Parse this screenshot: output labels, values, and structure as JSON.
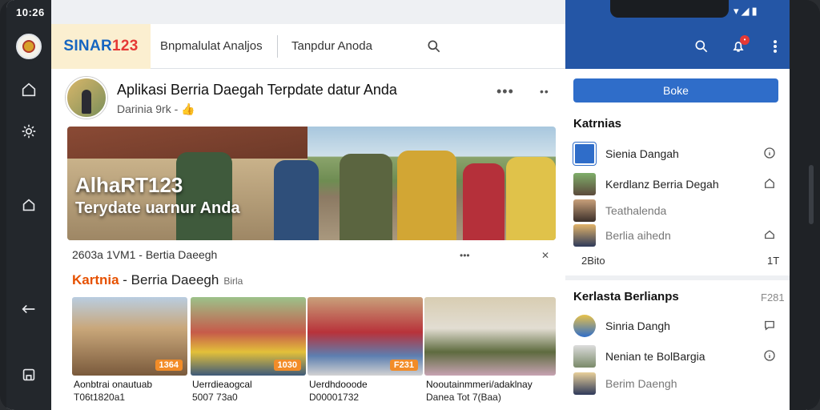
{
  "status": {
    "time": "10:26"
  },
  "colors": {
    "brand_blue": "#1565c0",
    "brand_red": "#e53935",
    "accent_orange": "#e65100",
    "panel_blue": "#2456a6",
    "button_blue": "#2f6dc9"
  },
  "rail": {
    "icons": [
      "home-icon",
      "gear-icon",
      "circle-home-icon",
      "back-icon",
      "square-home-icon"
    ]
  },
  "header": {
    "brand_text": "SINAR",
    "brand_num": "123",
    "menu1": "Bnpmalulat Analjos",
    "menu2": "Tanpdur Anoda"
  },
  "post": {
    "title": "Aplikasi Berria Daegah Terpdate datur Anda",
    "subtitle": "Darinia 9rk -",
    "hero_line1": "AlhaRT123",
    "hero_line2": "Terydate uarnur Anda",
    "meta": "2603a 1VM1   -  Bertia Daeegh"
  },
  "section": {
    "accent": "Kartnia",
    "title": " - Berria Daeegh",
    "tag": "Birla"
  },
  "cards": [
    {
      "badge": "1364",
      "cap1": "Aonbtrai onautuab",
      "cap2": "T06t1820a1"
    },
    {
      "badge": "1030",
      "cap1": "Uerrdieaogcal",
      "cap2": "5007 73a0"
    },
    {
      "badge": "F231",
      "cap1": "Uerdhdooode",
      "cap2": "D00001732"
    },
    {
      "badge": "",
      "cap1": "Nooutainmmeri/adaklnay",
      "cap2": "Danea Tot 7(Baa)"
    }
  ],
  "right": {
    "button": "Boke",
    "section1_title": "Katrnias",
    "rows1": [
      {
        "text": "Sienia Dangah"
      },
      {
        "text": "Kerdlanz Berria Degah"
      },
      {
        "text": "Teathalenda"
      },
      {
        "text": "Berlia aihedn"
      }
    ],
    "footer_left": "2Bito",
    "footer_right": "1T",
    "section2_title": "Kerlasta Berlianps",
    "section2_num": "F281",
    "rows2": [
      {
        "text": "Sinria Dangh"
      },
      {
        "text": "Nenian te BolBargia"
      },
      {
        "text": "Berim Daengh"
      }
    ]
  }
}
